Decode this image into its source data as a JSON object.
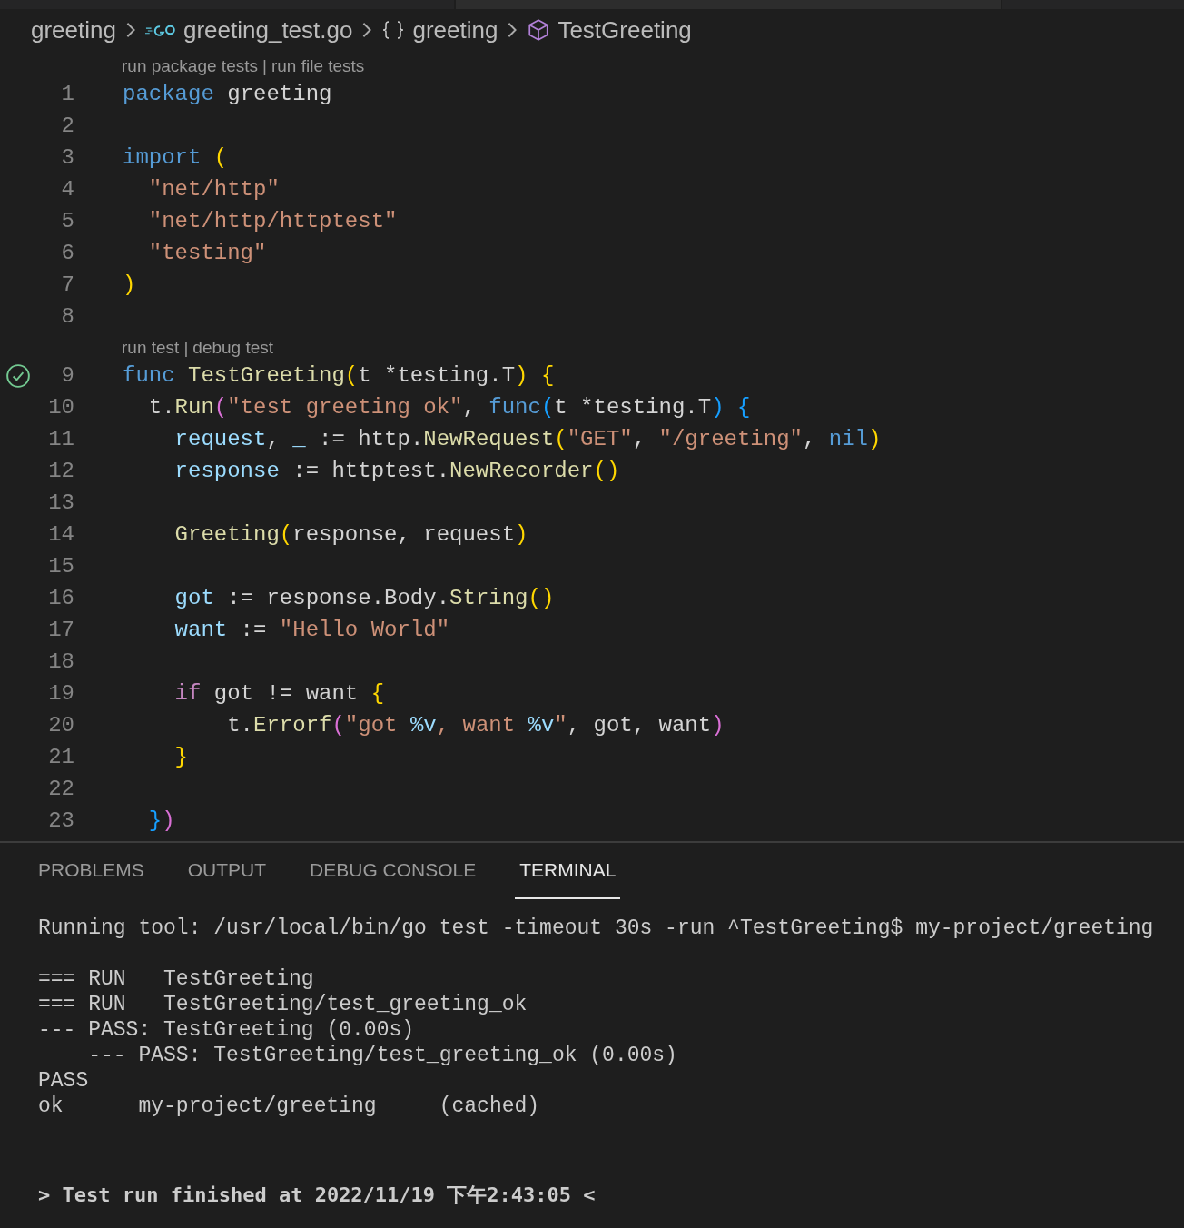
{
  "breadcrumb": [
    {
      "kind": "folder",
      "label": "greeting"
    },
    {
      "kind": "go-file",
      "label": "greeting_test.go"
    },
    {
      "kind": "namespace",
      "label": "greeting"
    },
    {
      "kind": "function",
      "label": "TestGreeting"
    }
  ],
  "editor": {
    "lines": [
      {
        "kind": "codelens",
        "links": [
          {
            "label": "run package tests"
          },
          {
            "label": "run file tests"
          }
        ],
        "separator": "|"
      },
      {
        "kind": "code",
        "number": "1",
        "tokens": [
          {
            "kind": "keyword",
            "text": "package"
          },
          {
            "kind": "plain",
            "text": " greeting"
          }
        ]
      },
      {
        "kind": "code",
        "number": "2"
      },
      {
        "kind": "code",
        "number": "3",
        "tokens": [
          {
            "kind": "keyword",
            "text": "import"
          },
          {
            "kind": "bracket1",
            "text": " ("
          }
        ]
      },
      {
        "kind": "code",
        "number": "4",
        "tokens": [
          {
            "kind": "string",
            "text": "  \"net/http\""
          }
        ]
      },
      {
        "kind": "code",
        "number": "5",
        "tokens": [
          {
            "kind": "string",
            "text": "  \"net/http/httptest\""
          }
        ]
      },
      {
        "kind": "code",
        "number": "6",
        "tokens": [
          {
            "kind": "string",
            "text": "  \"testing\""
          }
        ]
      },
      {
        "kind": "code",
        "number": "7",
        "tokens": [
          {
            "kind": "bracket1",
            "text": ")"
          }
        ]
      },
      {
        "kind": "code",
        "number": "8"
      },
      {
        "kind": "codelens",
        "links": [
          {
            "label": "run test"
          },
          {
            "label": "debug test"
          }
        ],
        "separator": "|"
      },
      {
        "kind": "code",
        "number": "9",
        "test_passed": true,
        "tokens": [
          {
            "kind": "keyword",
            "text": "func"
          },
          {
            "kind": "function",
            "text": " TestGreeting"
          },
          {
            "kind": "bracket1",
            "text": "("
          },
          {
            "kind": "plain",
            "text": "t *testing.T"
          },
          {
            "kind": "bracket1",
            "text": ") {"
          }
        ]
      },
      {
        "kind": "code",
        "number": "10",
        "tokens": [
          {
            "kind": "plain",
            "text": "  t."
          },
          {
            "kind": "function",
            "text": "Run"
          },
          {
            "kind": "bracket2",
            "text": "("
          },
          {
            "kind": "string",
            "text": "\"test greeting ok\""
          },
          {
            "kind": "plain",
            "text": ", "
          },
          {
            "kind": "keyword",
            "text": "func"
          },
          {
            "kind": "bracket3",
            "text": "("
          },
          {
            "kind": "plain",
            "text": "t *testing.T"
          },
          {
            "kind": "bracket3",
            "text": ") {"
          }
        ]
      },
      {
        "kind": "code",
        "number": "11",
        "tokens": [
          {
            "kind": "variable",
            "text": "    request"
          },
          {
            "kind": "plain",
            "text": ", "
          },
          {
            "kind": "variable",
            "text": "_"
          },
          {
            "kind": "plain",
            "text": " := http."
          },
          {
            "kind": "function",
            "text": "NewRequest"
          },
          {
            "kind": "bracket1",
            "text": "("
          },
          {
            "kind": "string",
            "text": "\"GET\""
          },
          {
            "kind": "plain",
            "text": ", "
          },
          {
            "kind": "string",
            "text": "\"/greeting\""
          },
          {
            "kind": "plain",
            "text": ", "
          },
          {
            "kind": "keyword",
            "text": "nil"
          },
          {
            "kind": "bracket1",
            "text": ")"
          }
        ]
      },
      {
        "kind": "code",
        "number": "12",
        "tokens": [
          {
            "kind": "variable",
            "text": "    response"
          },
          {
            "kind": "plain",
            "text": " := httptest."
          },
          {
            "kind": "function",
            "text": "NewRecorder"
          },
          {
            "kind": "bracket1",
            "text": "()"
          }
        ]
      },
      {
        "kind": "code",
        "number": "13"
      },
      {
        "kind": "code",
        "number": "14",
        "tokens": [
          {
            "kind": "function",
            "text": "    Greeting"
          },
          {
            "kind": "bracket1",
            "text": "("
          },
          {
            "kind": "plain",
            "text": "response, request"
          },
          {
            "kind": "bracket1",
            "text": ")"
          }
        ]
      },
      {
        "kind": "code",
        "number": "15"
      },
      {
        "kind": "code",
        "number": "16",
        "tokens": [
          {
            "kind": "variable",
            "text": "    got"
          },
          {
            "kind": "plain",
            "text": " := response.Body."
          },
          {
            "kind": "function",
            "text": "String"
          },
          {
            "kind": "bracket1",
            "text": "()"
          }
        ]
      },
      {
        "kind": "code",
        "number": "17",
        "tokens": [
          {
            "kind": "variable",
            "text": "    want"
          },
          {
            "kind": "plain",
            "text": " := "
          },
          {
            "kind": "string",
            "text": "\"Hello World\""
          }
        ]
      },
      {
        "kind": "code",
        "number": "18"
      },
      {
        "kind": "code",
        "number": "19",
        "tokens": [
          {
            "kind": "control",
            "text": "    if"
          },
          {
            "kind": "plain",
            "text": " got != want"
          },
          {
            "kind": "bracket1",
            "text": " {"
          }
        ]
      },
      {
        "kind": "code",
        "number": "20",
        "tokens": [
          {
            "kind": "plain",
            "text": "        t."
          },
          {
            "kind": "function",
            "text": "Errorf"
          },
          {
            "kind": "bracket2",
            "text": "("
          },
          {
            "kind": "string",
            "text": "\"got "
          },
          {
            "kind": "variable",
            "text": "%v"
          },
          {
            "kind": "string",
            "text": ", want "
          },
          {
            "kind": "variable",
            "text": "%v"
          },
          {
            "kind": "string",
            "text": "\""
          },
          {
            "kind": "plain",
            "text": ", got, want"
          },
          {
            "kind": "bracket2",
            "text": ")"
          }
        ]
      },
      {
        "kind": "code",
        "number": "21",
        "tokens": [
          {
            "kind": "bracket1",
            "text": "    }"
          }
        ]
      },
      {
        "kind": "code",
        "number": "22"
      },
      {
        "kind": "code",
        "number": "23",
        "tokens": [
          {
            "kind": "bracket3",
            "text": "  }"
          },
          {
            "kind": "bracket2",
            "text": ")"
          }
        ]
      }
    ]
  },
  "panel": {
    "tabs": [
      {
        "label": "PROBLEMS",
        "selected": false
      },
      {
        "label": "OUTPUT",
        "selected": false
      },
      {
        "label": "DEBUG CONSOLE",
        "selected": false
      },
      {
        "label": "TERMINAL",
        "selected": true
      }
    ],
    "terminal": [
      {
        "kind": "command",
        "text": "Running tool: /usr/local/bin/go test -timeout 30s -run ^TestGreeting$ my-project/greeting"
      },
      {
        "kind": "output",
        "text": "=== RUN   TestGreeting"
      },
      {
        "kind": "output",
        "text": "=== RUN   TestGreeting/test_greeting_ok"
      },
      {
        "kind": "output",
        "text": "--- PASS: TestGreeting (0.00s)"
      },
      {
        "kind": "output",
        "text": "    --- PASS: TestGreeting/test_greeting_ok (0.00s)"
      },
      {
        "kind": "output",
        "text": "PASS"
      },
      {
        "kind": "output",
        "text": "ok      my-project/greeting     (cached)"
      },
      {
        "kind": "summary",
        "text": "> Test run finished at 2022/11/19 下午2:43:05 <"
      }
    ]
  }
}
